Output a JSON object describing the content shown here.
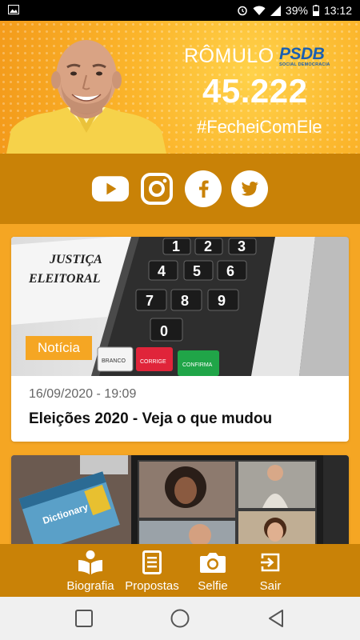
{
  "status_bar": {
    "battery": "39%",
    "time": "13:12",
    "icons": [
      "image-icon",
      "alarm-icon",
      "wifi-icon",
      "signal-icon",
      "battery-icon"
    ]
  },
  "banner": {
    "name": "RÔMULO",
    "party": "PSDB",
    "party_subtitle": "SOCIAL DEMOCRACIA",
    "number": "45.222",
    "hashtag": "#FecheiComEle",
    "colors": {
      "accent": "#f5a623",
      "party_blue": "#1b5fb0"
    }
  },
  "social": [
    {
      "name": "youtube",
      "icon": "youtube-icon"
    },
    {
      "name": "instagram",
      "icon": "instagram-icon"
    },
    {
      "name": "facebook",
      "icon": "facebook-icon"
    },
    {
      "name": "twitter",
      "icon": "twitter-icon"
    }
  ],
  "feed": {
    "cards": [
      {
        "category": "Notícia",
        "date": "16/09/2020 - 19:09",
        "title": "Eleições 2020 - Veja o que mudou",
        "image_text": {
          "line1": "JUSTIÇA",
          "line2": "ELEITORAL",
          "branco": "BRANCO",
          "corrige": "CORRIGE",
          "confirma": "CONFIRMA"
        }
      },
      {
        "image_text": {
          "book": "Dictionary"
        }
      }
    ]
  },
  "bottom_nav": {
    "items": [
      {
        "label": "Biografia",
        "icon": "book-reader-icon"
      },
      {
        "label": "Propostas",
        "icon": "document-icon"
      },
      {
        "label": "Selfie",
        "icon": "camera-icon"
      },
      {
        "label": "Sair",
        "icon": "logout-icon"
      }
    ],
    "color": "#c98207"
  },
  "system_nav": {
    "buttons": [
      "recents-icon",
      "home-icon",
      "back-icon"
    ]
  }
}
